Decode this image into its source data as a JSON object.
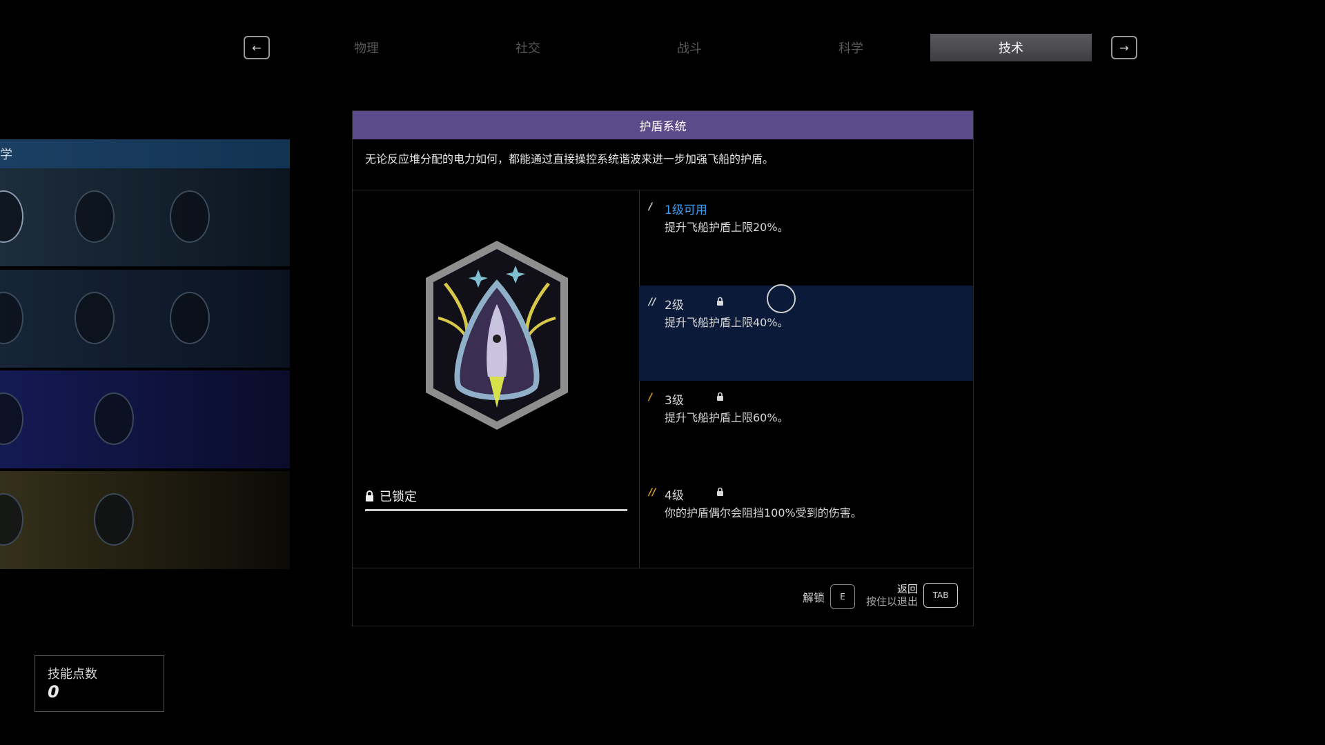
{
  "tabs": {
    "items": [
      "物理",
      "社交",
      "战斗",
      "科学",
      "技术"
    ],
    "active": "技术",
    "prev_icon": "arrow-left-icon",
    "next_icon": "arrow-right-icon"
  },
  "tree": {
    "header_partial": "学"
  },
  "skill": {
    "title": "护盾系统",
    "description": "无论反应堆分配的电力如何，都能通过直接操控系统谐波来进一步加强飞船的护盾。",
    "status_label": "已锁定",
    "ranks": [
      {
        "title": "1级可用",
        "desc": "提升飞船护盾上限20%。",
        "color": "#3d9cf0",
        "locked": false
      },
      {
        "title": "2级",
        "desc": "提升飞船护盾上限40%。",
        "color": "#d8d8d8",
        "locked": true
      },
      {
        "title": "3级",
        "desc": "提升飞船护盾上限60%。",
        "color": "#d8d8d8",
        "locked": true
      },
      {
        "title": "4级",
        "desc": "你的护盾偶尔会阻挡100%受到的伤害。",
        "color": "#d8d8d8",
        "locked": true
      }
    ]
  },
  "footer": {
    "unlock_label": "解锁",
    "unlock_key": "E",
    "back_label": "返回",
    "hold_label": "按住以退出",
    "back_key": "TAB"
  },
  "skill_points": {
    "label": "技能点数",
    "value": "0"
  },
  "colors": {
    "accent_purple": "#5d4a8a",
    "rank1_blue": "#3d9cf0",
    "rank_gold": "#e6a21f"
  }
}
